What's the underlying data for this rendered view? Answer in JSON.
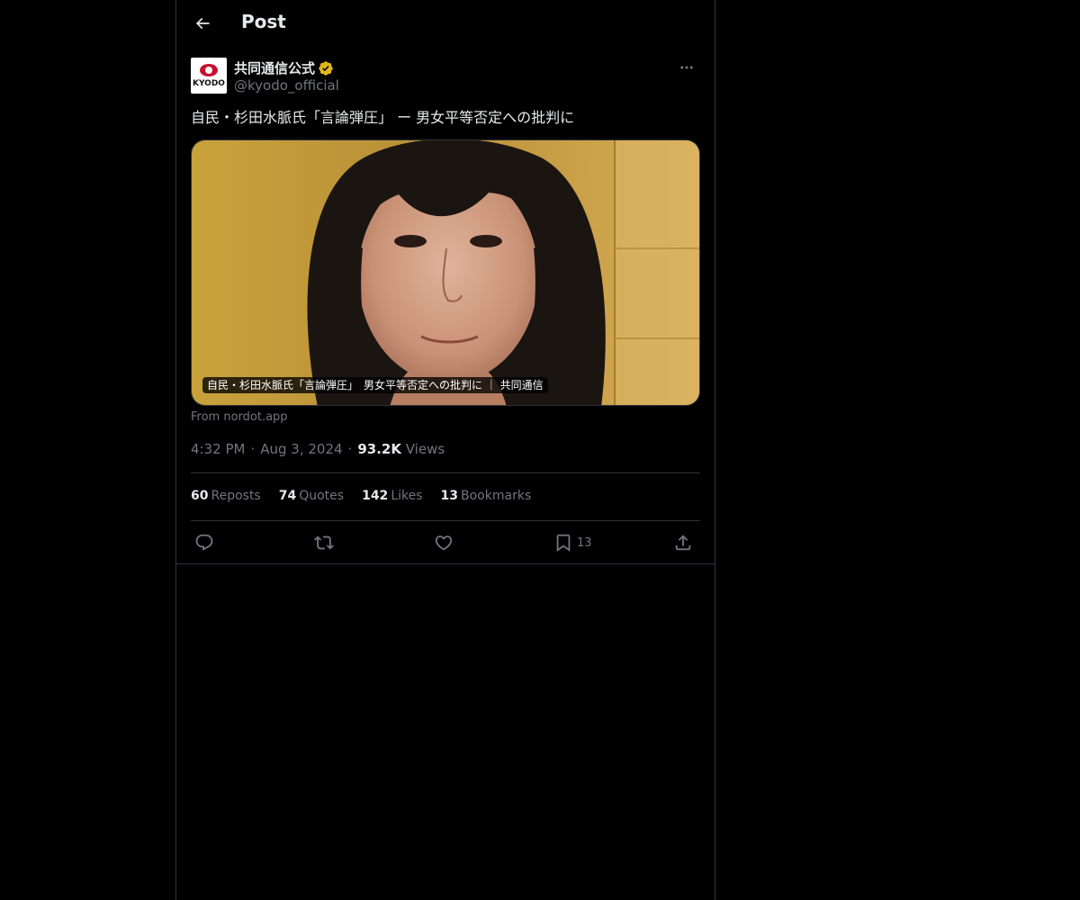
{
  "header": {
    "back_icon": "arrow-left-icon",
    "title": "Post"
  },
  "author": {
    "display_name": "共同通信公式",
    "handle": "@kyodo_official",
    "avatar_text": "KYODO",
    "verified_color": "#e2b719",
    "verified_icon": "verified-badge-icon"
  },
  "tweet": {
    "text": "自民・杉田水脈氏「言論弾圧」 ー 男女平等否定への批判に"
  },
  "card": {
    "caption": "自民・杉田水脈氏「言論弾圧」　男女平等否定への批判に ｜ 共同通信",
    "source": "From nordot.app"
  },
  "meta": {
    "time": "4:32 PM",
    "date": "Aug 3, 2024",
    "views_count": "93.2K",
    "views_label": "Views"
  },
  "stats": [
    {
      "count": "60",
      "label": "Reposts"
    },
    {
      "count": "74",
      "label": "Quotes"
    },
    {
      "count": "142",
      "label": "Likes"
    },
    {
      "count": "13",
      "label": "Bookmarks"
    }
  ],
  "actions": {
    "reply_icon": "reply-icon",
    "repost_icon": "repost-icon",
    "like_icon": "heart-icon",
    "bookmark_icon": "bookmark-icon",
    "bookmark_count": "13",
    "share_icon": "share-icon"
  },
  "colors": {
    "background": "#000000",
    "text_primary": "#e7e9ea",
    "text_secondary": "#71767b",
    "border": "#2f3336"
  }
}
